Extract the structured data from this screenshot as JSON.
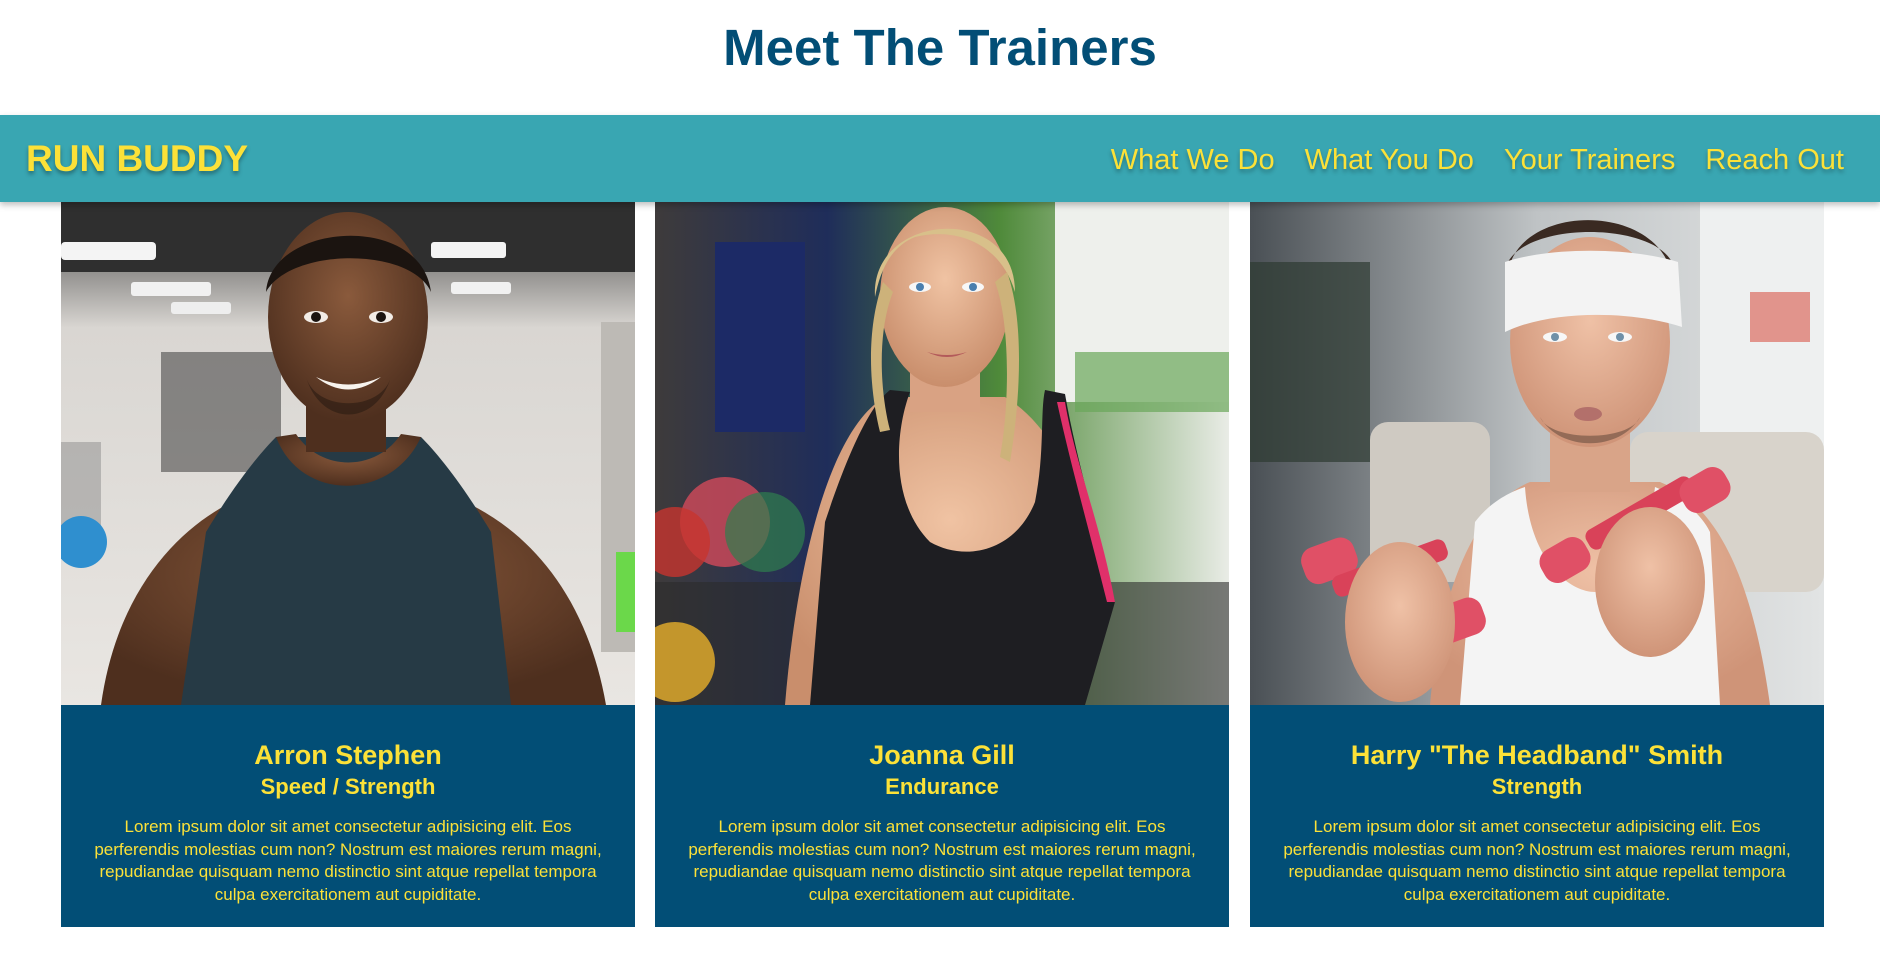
{
  "page": {
    "title": "Meet The Trainers"
  },
  "header": {
    "brand": "RUN BUDDY",
    "nav": [
      {
        "label": "What We Do"
      },
      {
        "label": "What You Do"
      },
      {
        "label": "Your Trainers"
      },
      {
        "label": "Reach Out"
      }
    ]
  },
  "colors": {
    "title": "#024e76",
    "navbar_bg": "#39a6b2",
    "accent_yellow": "#fce138",
    "card_bg": "#024e76"
  },
  "trainers": [
    {
      "name": "Arron Stephen",
      "role": "Speed / Strength",
      "bio": "Lorem ipsum dolor sit amet consectetur adipisicing elit. Eos perferendis molestias cum non? Nostrum est maiores rerum magni, repudiandae quisquam nemo distinctio sint atque repellat tempora culpa exercitationem aut cupiditate.",
      "photo": "trainer-photo-man-tank-top"
    },
    {
      "name": "Joanna Gill",
      "role": "Endurance",
      "bio": "Lorem ipsum dolor sit amet consectetur adipisicing elit. Eos perferendis molestias cum non? Nostrum est maiores rerum magni, repudiandae quisquam nemo distinctio sint atque repellat tempora culpa exercitationem aut cupiditate.",
      "photo": "trainer-photo-woman-tank-top"
    },
    {
      "name": "Harry \"The Headband\" Smith",
      "role": "Strength",
      "bio": "Lorem ipsum dolor sit amet consectetur adipisicing elit. Eos perferendis molestias cum non? Nostrum est maiores rerum magni, repudiandae quisquam nemo distinctio sint atque repellat tempora culpa exercitationem aut cupiditate.",
      "photo": "trainer-photo-man-headband-dumbbells"
    }
  ]
}
